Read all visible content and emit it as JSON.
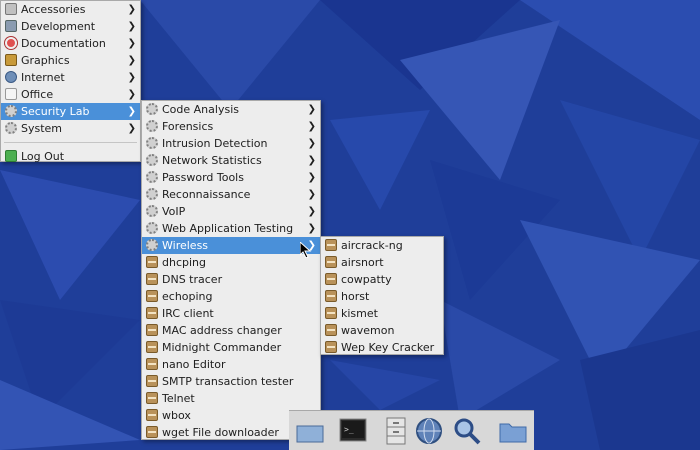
{
  "main_menu": {
    "items": [
      {
        "label": "Accessories",
        "icon": "accessories-icon",
        "has_submenu": true
      },
      {
        "label": "Development",
        "icon": "development-icon",
        "has_submenu": true
      },
      {
        "label": "Documentation",
        "icon": "documentation-icon",
        "has_submenu": true
      },
      {
        "label": "Graphics",
        "icon": "graphics-icon",
        "has_submenu": true
      },
      {
        "label": "Internet",
        "icon": "internet-icon",
        "has_submenu": true
      },
      {
        "label": "Office",
        "icon": "office-icon",
        "has_submenu": true
      },
      {
        "label": "Security Lab",
        "icon": "gear-icon",
        "has_submenu": true,
        "active": true
      },
      {
        "label": "System",
        "icon": "gear-icon",
        "has_submenu": true
      }
    ],
    "logout_label": "Log Out"
  },
  "security_lab_menu": {
    "items": [
      {
        "label": "Code Analysis",
        "icon": "gear-icon",
        "has_submenu": true
      },
      {
        "label": "Forensics",
        "icon": "gear-icon",
        "has_submenu": true
      },
      {
        "label": "Intrusion Detection",
        "icon": "gear-icon",
        "has_submenu": true
      },
      {
        "label": "Network Statistics",
        "icon": "gear-icon",
        "has_submenu": true
      },
      {
        "label": "Password Tools",
        "icon": "gear-icon",
        "has_submenu": true
      },
      {
        "label": "Reconnaissance",
        "icon": "gear-icon",
        "has_submenu": true
      },
      {
        "label": "VoIP",
        "icon": "gear-icon",
        "has_submenu": true
      },
      {
        "label": "Web Application Testing",
        "icon": "gear-icon",
        "has_submenu": true
      },
      {
        "label": "Wireless",
        "icon": "gear-icon",
        "has_submenu": true,
        "active": true
      },
      {
        "label": "dhcping",
        "icon": "package-icon"
      },
      {
        "label": "DNS tracer",
        "icon": "package-icon"
      },
      {
        "label": "echoping",
        "icon": "package-icon"
      },
      {
        "label": "IRC client",
        "icon": "package-icon"
      },
      {
        "label": "MAC address changer",
        "icon": "package-icon"
      },
      {
        "label": "Midnight Commander",
        "icon": "package-icon"
      },
      {
        "label": "nano Editor",
        "icon": "package-icon"
      },
      {
        "label": "SMTP transaction tester",
        "icon": "package-icon"
      },
      {
        "label": "Telnet",
        "icon": "package-icon"
      },
      {
        "label": "wbox",
        "icon": "package-icon"
      },
      {
        "label": "wget File downloader",
        "icon": "package-icon"
      }
    ]
  },
  "wireless_menu": {
    "items": [
      {
        "label": "aircrack-ng",
        "icon": "package-icon"
      },
      {
        "label": "airsnort",
        "icon": "package-icon"
      },
      {
        "label": "cowpatty",
        "icon": "package-icon"
      },
      {
        "label": "horst",
        "icon": "package-icon"
      },
      {
        "label": "kismet",
        "icon": "package-icon"
      },
      {
        "label": "wavemon",
        "icon": "package-icon"
      },
      {
        "label": "Wep Key Cracker",
        "icon": "package-icon"
      }
    ]
  },
  "taskbar": {
    "launchers": [
      "desktop-icon",
      "terminal-icon",
      "file-cabinet-icon",
      "web-browser-icon",
      "search-icon",
      "folder-icon"
    ]
  },
  "colors": {
    "desktop_bg": "#1f3e99",
    "menu_bg": "#ededed",
    "highlight": "#4a90d9"
  }
}
